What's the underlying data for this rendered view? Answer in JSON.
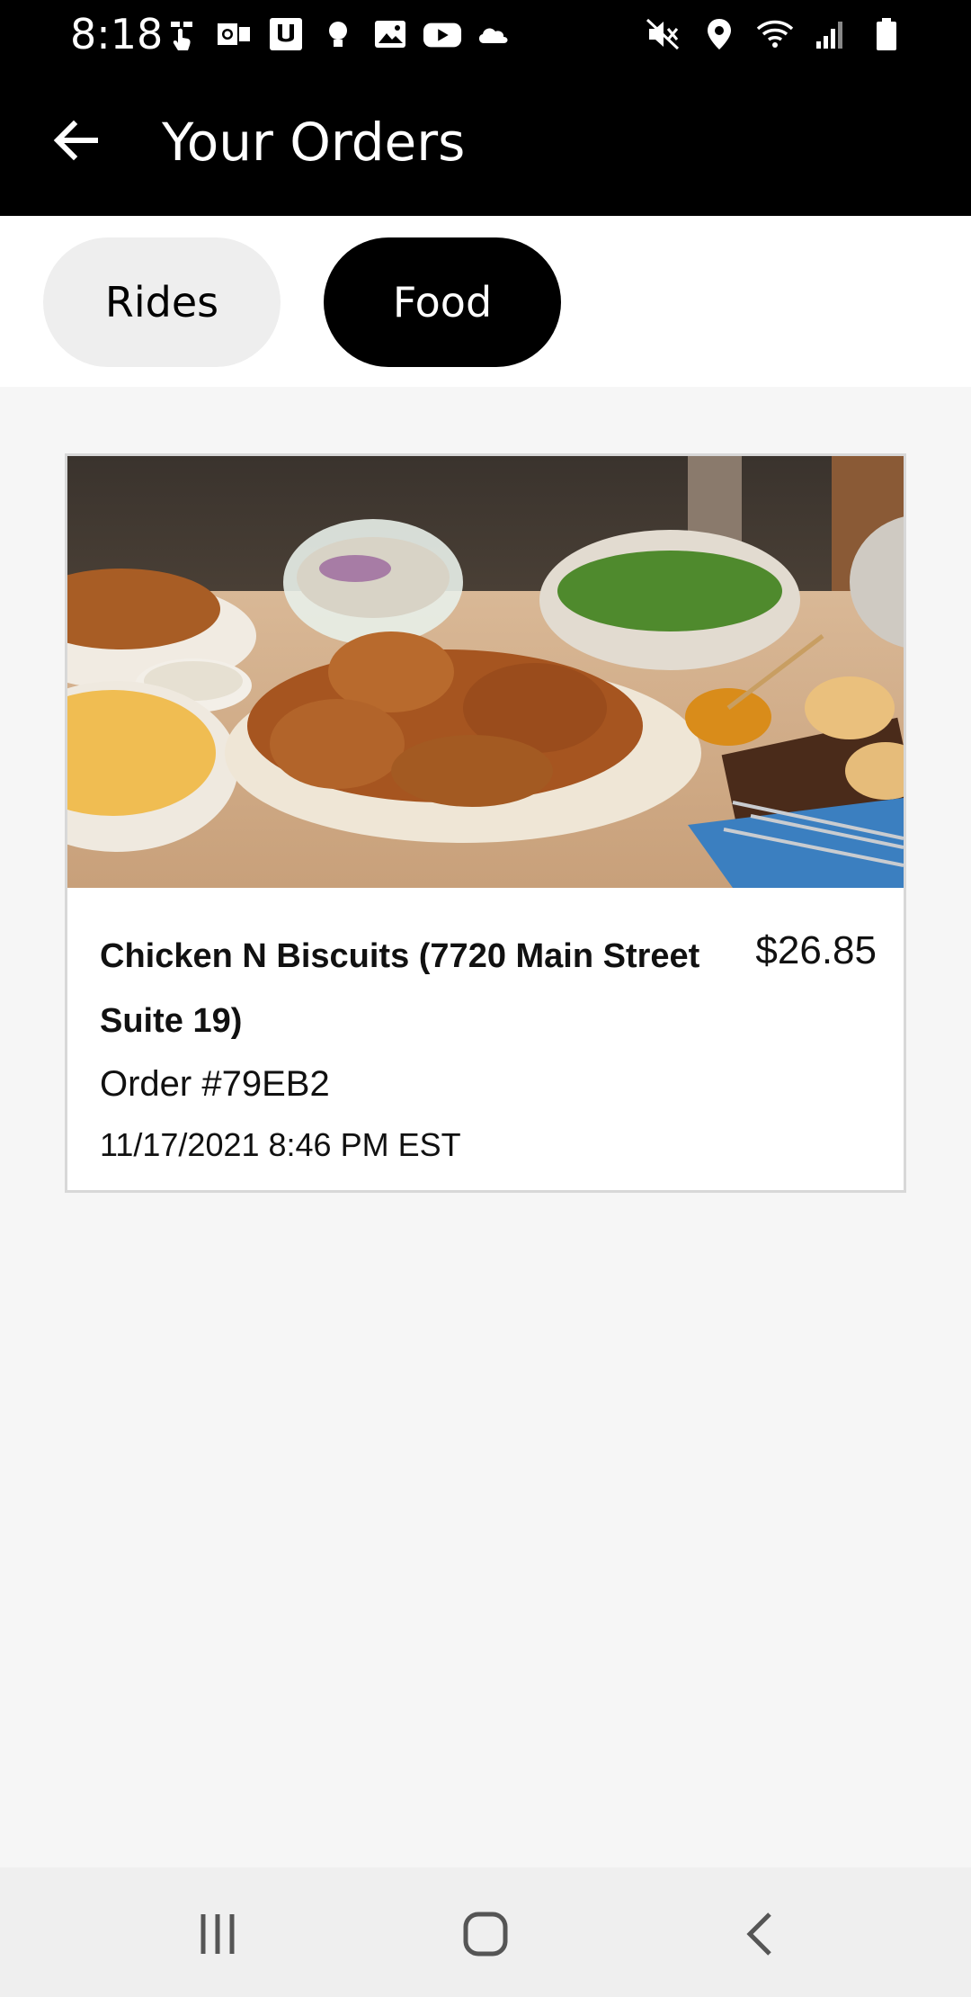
{
  "status_bar": {
    "time": "8:18",
    "left_icons": [
      "touch-icon",
      "outlook-icon",
      "u-app-icon",
      "bulb-icon",
      "image-icon",
      "youtube-icon",
      "cloud-icon"
    ],
    "right_icons": [
      "mute-icon",
      "location-icon",
      "wifi-icon",
      "signal-icon",
      "battery-icon"
    ]
  },
  "header": {
    "title": "Your Orders",
    "back_icon": "arrow-left-icon"
  },
  "tabs": [
    {
      "label": "Rides",
      "selected": false
    },
    {
      "label": "Food",
      "selected": true
    }
  ],
  "orders": [
    {
      "restaurant": "Chicken N Biscuits (7720 Main Street Suite 19)",
      "price": "$26.85",
      "order_number": "Order #79EB2",
      "date": "11/17/2021 8:46 PM EST",
      "image": "fried-chicken-meal-photo"
    }
  ],
  "nav": {
    "recent": "recent-apps-icon",
    "home": "home-icon",
    "back": "back-icon"
  },
  "colors": {
    "app_bar": "#000000",
    "selected_tab": "#000000",
    "unselected_tab": "#eeeeee",
    "background": "#f6f6f6"
  }
}
